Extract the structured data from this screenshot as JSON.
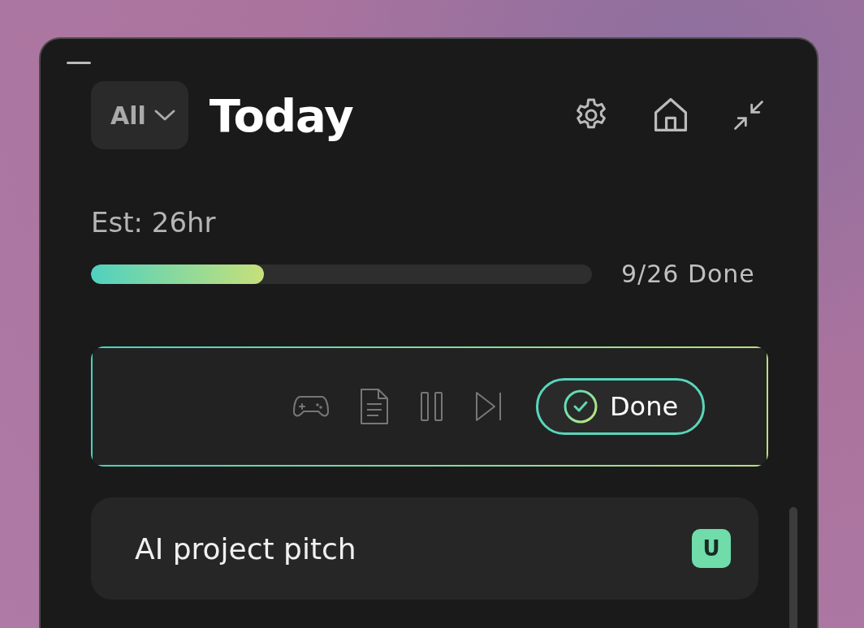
{
  "filter": {
    "label": "All"
  },
  "title": "Today",
  "estimate": "Est: 26hr",
  "progress": {
    "level": 0.346,
    "label": "9/26 Done"
  },
  "controls": {
    "done_label": "Done"
  },
  "tasks": [
    {
      "title": "AI project pitch",
      "badge": "U"
    }
  ]
}
